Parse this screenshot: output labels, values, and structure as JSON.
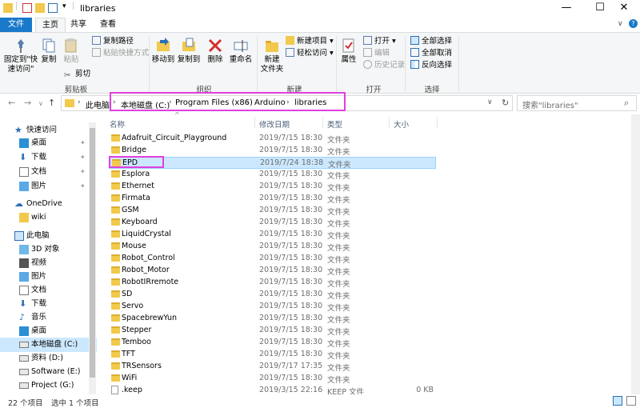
{
  "window": {
    "title": "libraries",
    "minimize": "—",
    "maximize": "☐",
    "close": "✕"
  },
  "tabs": {
    "file": "文件",
    "home": "主页",
    "share": "共享",
    "view": "查看"
  },
  "ribbon": {
    "clipboard": {
      "pin_quick_access": "固定到\"快\n速访问\"",
      "copy": "复制",
      "paste": "粘贴",
      "copy_path": "复制路径",
      "paste_shortcut": "粘贴快捷方式",
      "cut": "剪切",
      "group_label": "剪贴板"
    },
    "organize": {
      "move_to": "移动到",
      "copy_to": "复制到",
      "delete": "删除",
      "rename": "重命名",
      "group_label": "组织"
    },
    "new": {
      "new_folder": "新建\n文件夹",
      "new_item": "新建项目 ▾",
      "easy_access": "轻松访问 ▾",
      "group_label": "新建"
    },
    "open": {
      "properties": "属性",
      "open": "打开 ▾",
      "edit": "编辑",
      "history": "历史记录",
      "group_label": "打开"
    },
    "select": {
      "select_all": "全部选择",
      "select_none": "全部取消",
      "invert": "反向选择",
      "group_label": "选择"
    }
  },
  "address": {
    "crumbs": [
      "此电脑",
      "本地磁盘 (C:)",
      "Program Files (x86)",
      "Arduino",
      "libraries"
    ],
    "search_placeholder": "搜索\"libraries\""
  },
  "nav": {
    "quick_access": "快速访问",
    "desktop": "桌面",
    "downloads": "下载",
    "documents": "文档",
    "pictures": "图片",
    "onedrive": "OneDrive",
    "wiki": "wiki",
    "this_pc": "此电脑",
    "objects3d": "3D 对象",
    "videos": "视频",
    "pictures2": "图片",
    "documents2": "文档",
    "downloads2": "下载",
    "music": "音乐",
    "desktop2": "桌面",
    "local_disk": "本地磁盘 (C:)",
    "data_d": "资料 (D:)",
    "software_e": "Software (E:)",
    "project_g": "Project (G:)"
  },
  "columns": {
    "name": "名称",
    "date": "修改日期",
    "type": "类型",
    "size": "大小"
  },
  "files": [
    {
      "name": "Adafruit_Circuit_Playground",
      "date": "2019/7/15 18:30",
      "type": "文件夹",
      "size": ""
    },
    {
      "name": "Bridge",
      "date": "2019/7/15 18:30",
      "type": "文件夹",
      "size": ""
    },
    {
      "name": "EPD",
      "date": "2019/7/24 18:38",
      "type": "文件夹",
      "size": ""
    },
    {
      "name": "Esplora",
      "date": "2019/7/15 18:30",
      "type": "文件夹",
      "size": ""
    },
    {
      "name": "Ethernet",
      "date": "2019/7/15 18:30",
      "type": "文件夹",
      "size": ""
    },
    {
      "name": "Firmata",
      "date": "2019/7/15 18:30",
      "type": "文件夹",
      "size": ""
    },
    {
      "name": "GSM",
      "date": "2019/7/15 18:30",
      "type": "文件夹",
      "size": ""
    },
    {
      "name": "Keyboard",
      "date": "2019/7/15 18:30",
      "type": "文件夹",
      "size": ""
    },
    {
      "name": "LiquidCrystal",
      "date": "2019/7/15 18:30",
      "type": "文件夹",
      "size": ""
    },
    {
      "name": "Mouse",
      "date": "2019/7/15 18:30",
      "type": "文件夹",
      "size": ""
    },
    {
      "name": "Robot_Control",
      "date": "2019/7/15 18:30",
      "type": "文件夹",
      "size": ""
    },
    {
      "name": "Robot_Motor",
      "date": "2019/7/15 18:30",
      "type": "文件夹",
      "size": ""
    },
    {
      "name": "RobotIRremote",
      "date": "2019/7/15 18:30",
      "type": "文件夹",
      "size": ""
    },
    {
      "name": "SD",
      "date": "2019/7/15 18:30",
      "type": "文件夹",
      "size": ""
    },
    {
      "name": "Servo",
      "date": "2019/7/15 18:30",
      "type": "文件夹",
      "size": ""
    },
    {
      "name": "SpacebrewYun",
      "date": "2019/7/15 18:30",
      "type": "文件夹",
      "size": ""
    },
    {
      "name": "Stepper",
      "date": "2019/7/15 18:30",
      "type": "文件夹",
      "size": ""
    },
    {
      "name": "Temboo",
      "date": "2019/7/15 18:30",
      "type": "文件夹",
      "size": ""
    },
    {
      "name": "TFT",
      "date": "2019/7/15 18:30",
      "type": "文件夹",
      "size": ""
    },
    {
      "name": "TRSensors",
      "date": "2019/7/17 17:35",
      "type": "文件夹",
      "size": ""
    },
    {
      "name": "WiFi",
      "date": "2019/7/15 18:30",
      "type": "文件夹",
      "size": ""
    },
    {
      "name": ".keep",
      "date": "2019/3/15 22:16",
      "type": "KEEP 文件",
      "size": "0 KB"
    }
  ],
  "status": {
    "count": "22 个项目",
    "selected": "选中 1 个项目"
  },
  "colors": {
    "accent": "#1979ca",
    "selection": "#cce8ff",
    "highlight": "#e040e0",
    "folder": "#f2c94c"
  }
}
